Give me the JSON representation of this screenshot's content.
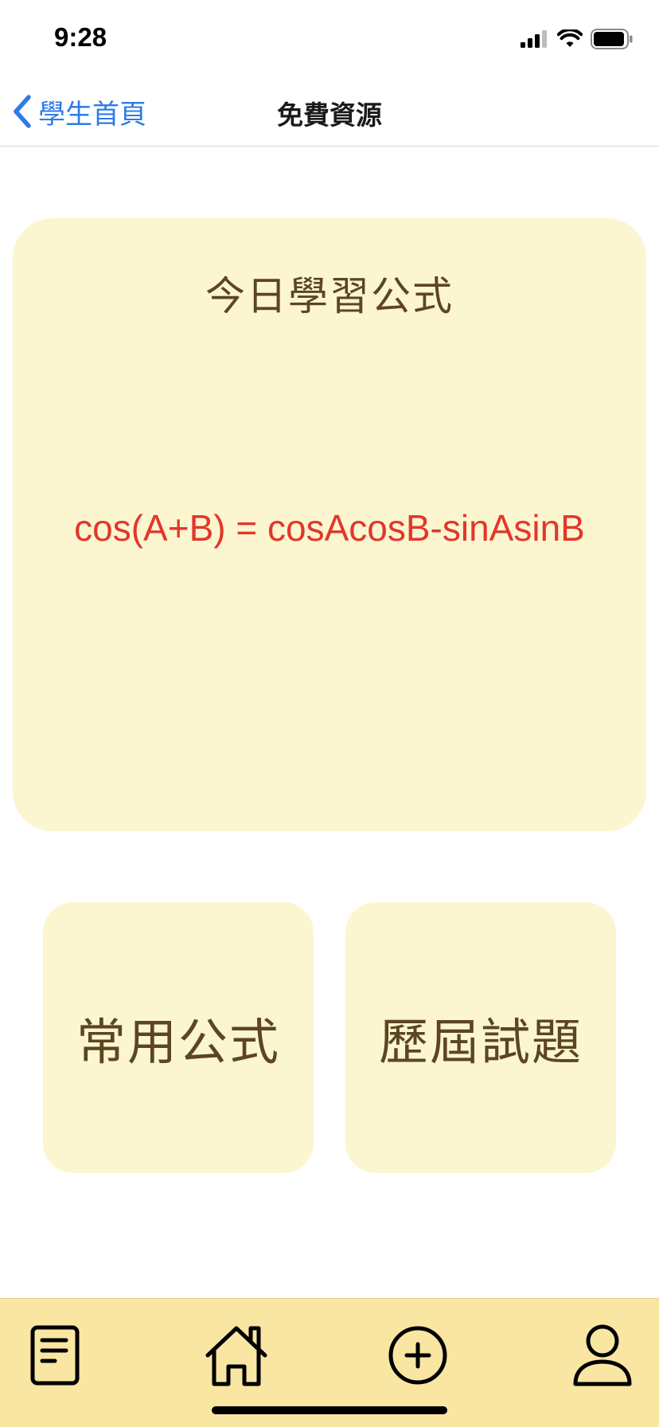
{
  "status_bar": {
    "time": "9:28"
  },
  "nav": {
    "back_label": "學生首頁",
    "title": "免費資源"
  },
  "today": {
    "title": "今日學習公式",
    "formula": "cos(A+B) = cosAcosB-sinAsinB"
  },
  "resources": {
    "common_formulas": "常用公式",
    "past_exams": "歷屆試題"
  },
  "tab_bar": {
    "icons": [
      "document-icon",
      "home-icon",
      "add-circle-icon",
      "profile-icon"
    ]
  },
  "colors": {
    "accent": "#2f7be6",
    "card_bg": "#fbf6d0",
    "tab_bg": "#f9e6a2",
    "formula": "#e2372a",
    "card_text": "#5d4521"
  }
}
